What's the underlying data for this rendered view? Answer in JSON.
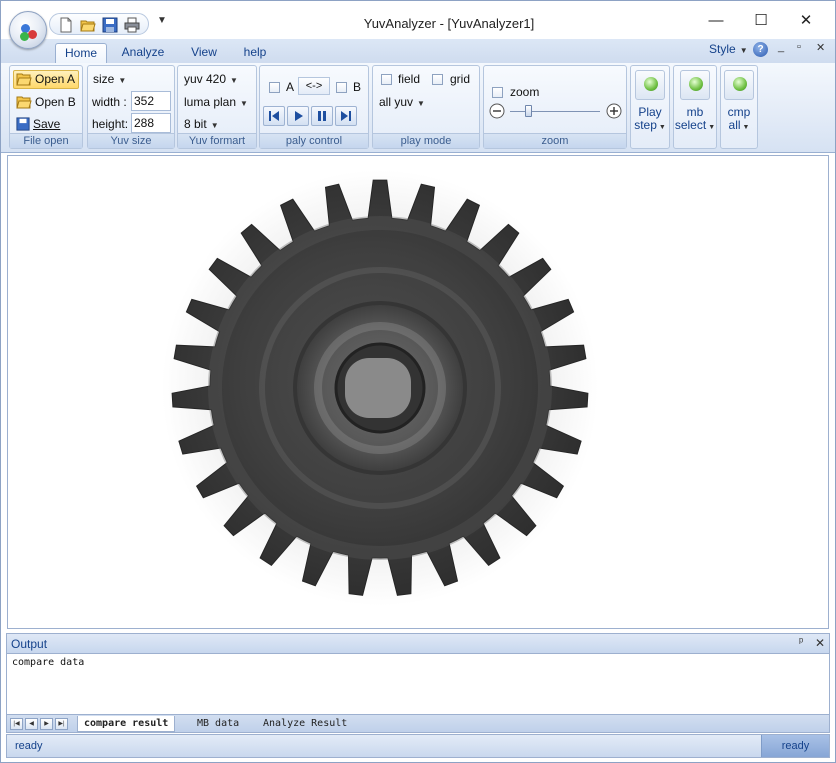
{
  "window": {
    "title": "YuvAnalyzer - [YuvAnalyzer1]",
    "minimize_glyph": "—",
    "maximize_glyph": "☐",
    "close_glyph": "✕"
  },
  "quick_access": {
    "more_glyph": "▼",
    "icons": [
      "new-file-icon",
      "open-folder-icon",
      "save-icon",
      "print-icon"
    ]
  },
  "ribbon_tabs": [
    {
      "label": "Home",
      "active": true
    },
    {
      "label": "Analyze",
      "active": false
    },
    {
      "label": "View",
      "active": false
    },
    {
      "label": "help",
      "active": false
    }
  ],
  "ribbon_right": {
    "style_label": "Style",
    "help_glyph": "?",
    "mdi_min": "_",
    "mdi_restore": "▫",
    "mdi_close": "✕"
  },
  "groups": {
    "file_open": {
      "caption": "File open",
      "open_a": "Open A",
      "open_b": "Open B",
      "save": "Save"
    },
    "yuv_size": {
      "caption": "Yuv size",
      "size_label": "size",
      "width_label": "width :",
      "width_value": "352",
      "height_label": "height:",
      "height_value": "288"
    },
    "yuv_format": {
      "caption": "Yuv formart",
      "format": "yuv 420",
      "plane": "luma plan",
      "bits": "8 bit"
    },
    "play_control": {
      "caption": "paly control",
      "a_label": "A",
      "swap_label": "<->",
      "b_label": "B"
    },
    "play_mode": {
      "caption": "play mode",
      "field_label": "field",
      "grid_label": "grid",
      "mode": "all yuv"
    },
    "zoom": {
      "caption": "zoom",
      "zoom_label": "zoom",
      "level": 0.2
    },
    "big_buttons": [
      {
        "line1": "Play",
        "line2": "step"
      },
      {
        "line1": "mb",
        "line2": "select"
      },
      {
        "line1": "cmp",
        "line2": "all"
      }
    ]
  },
  "output": {
    "title": "Output",
    "pin_glyph": "ᵖ",
    "close_glyph": "✕",
    "text": "compare data"
  },
  "output_tabs": [
    {
      "label": "compare result",
      "active": true
    },
    {
      "label": "MB data",
      "active": false
    },
    {
      "label": "Analyze Result",
      "active": false
    }
  ],
  "status": {
    "left": "ready",
    "right": "ready"
  },
  "colors": {
    "accent": "#15428b",
    "ribbon_bg": "#dfe8f6",
    "selected_button": "#ffd86b"
  }
}
